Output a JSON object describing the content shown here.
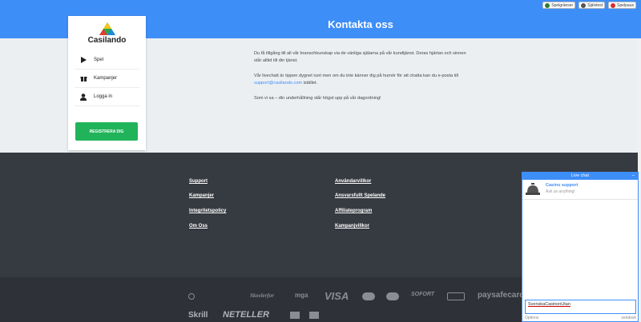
{
  "header": {
    "title": "Kontakta oss",
    "badges": [
      {
        "label": "Spelgränser",
        "color": "#2e7d32"
      },
      {
        "label": "Självtest",
        "color": "#555555"
      },
      {
        "label": "Spelpaus",
        "color": "#d32f2f"
      }
    ]
  },
  "sidebar": {
    "brand": "Casilando",
    "items": [
      {
        "label": "Spel",
        "icon": "play-icon"
      },
      {
        "label": "Kampanjer",
        "icon": "gift-icon"
      },
      {
        "label": "Logga in",
        "icon": "user-icon"
      }
    ],
    "register_label": "REGISTRERA DIG"
  },
  "main": {
    "para1": "Du få tillgång till all vår branschkunskap via de vänliga själarna på vår kundtjänst. Deras hjärtan och sinnen står alltid till din tjänst.",
    "para2_pre": "Vår livechatt är öppen dygnet runt men om du inte känner dig på humör för att chatta kan du e-posta till ",
    "email": "support@casilando.com",
    "para2_post": " istället.",
    "para3": "Som vi sa – din underhållning står högst upp på vår dagordning!"
  },
  "footer": {
    "col1": [
      "Support",
      "Kampanjer",
      "Integritetspolicy",
      "Om Oss"
    ],
    "col2": [
      "Användarvillkor",
      "Ansvarsfullt Spelande",
      "Affiliateprogram",
      "Kampanjvillkor"
    ],
    "payments": [
      "VISA",
      "SOFORT",
      "paysafecard",
      "Skrill",
      "NETELLER",
      "mga",
      "Skeelerfor"
    ]
  },
  "chat": {
    "title": "Live chat",
    "minimize": "–",
    "agent_name": "Casino support",
    "agent_sub": "Ask us anything!",
    "input_value": "SvenskaCasinonUtan",
    "options_label": "Options",
    "powered_label": "zendesk"
  },
  "colors": {
    "accent": "#3e8ef7",
    "register": "#21b35a",
    "footer": "#363a41"
  }
}
